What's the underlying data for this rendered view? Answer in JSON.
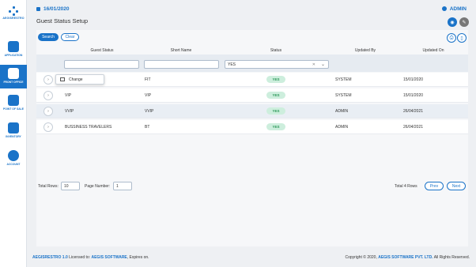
{
  "app": {
    "logo_text": "AEGISRESTRO"
  },
  "header": {
    "date": "16/01/2020",
    "user": "ADMIN"
  },
  "sidebar": {
    "items": [
      {
        "label": "APPLICATION",
        "icon": "application-icon"
      },
      {
        "label": "FRONT OFFICE",
        "icon": "front-office-icon"
      },
      {
        "label": "POINT OF SALE",
        "icon": "point-of-sale-icon"
      },
      {
        "label": "INVENTORY",
        "icon": "inventory-icon"
      },
      {
        "label": "ACCOUNT",
        "icon": "account-icon"
      }
    ]
  },
  "page": {
    "title": "Guest Status Setup"
  },
  "toolbar": {
    "search_label": "Search",
    "clear_label": "Clear"
  },
  "table": {
    "columns": [
      "Guest Status",
      "Short Name",
      "Status",
      "Updated By",
      "Updated On"
    ],
    "filter": {
      "status_value": "YES",
      "status_clear": "✕"
    },
    "rows": [
      {
        "guest_status": "",
        "short_name": "FIT",
        "status": "YES",
        "updated_by": "SYSTEM",
        "updated_on": "15/01/2020"
      },
      {
        "guest_status": "VIP",
        "short_name": "VIP",
        "status": "YES",
        "updated_by": "SYSTEM",
        "updated_on": "15/01/2020"
      },
      {
        "guest_status": "VVIP",
        "short_name": "VVIP",
        "status": "YES",
        "updated_by": "ADMIN",
        "updated_on": "26/04/2021"
      },
      {
        "guest_status": "BUSSINESS TRAVELERS",
        "short_name": "BT",
        "status": "YES",
        "updated_by": "ADMIN",
        "updated_on": "26/04/2021"
      }
    ],
    "context_menu": {
      "change_label": "Change"
    }
  },
  "pagination": {
    "total_rows_label": "Total Rows:",
    "total_rows_value": "10",
    "page_number_label": "Page Number:",
    "page_number_value": "1",
    "total_info": "Total 4 Rows",
    "prev_label": "Prev",
    "next_label": "Next"
  },
  "footer": {
    "product": "AEGISRESTRO 1.0",
    "licensed_text": "Licensed to:",
    "licensee": "AEGIS SOFTWARE",
    "expires_text": ", Expires on.",
    "copyright_text": "Copyright © 2020,",
    "company": "AEGIS SOFTWARE PVT. LTD.",
    "rights_text": "All Rights Reserved."
  },
  "colors": {
    "brand": "#1a73c8",
    "status_yes": "#2f9a5b"
  }
}
